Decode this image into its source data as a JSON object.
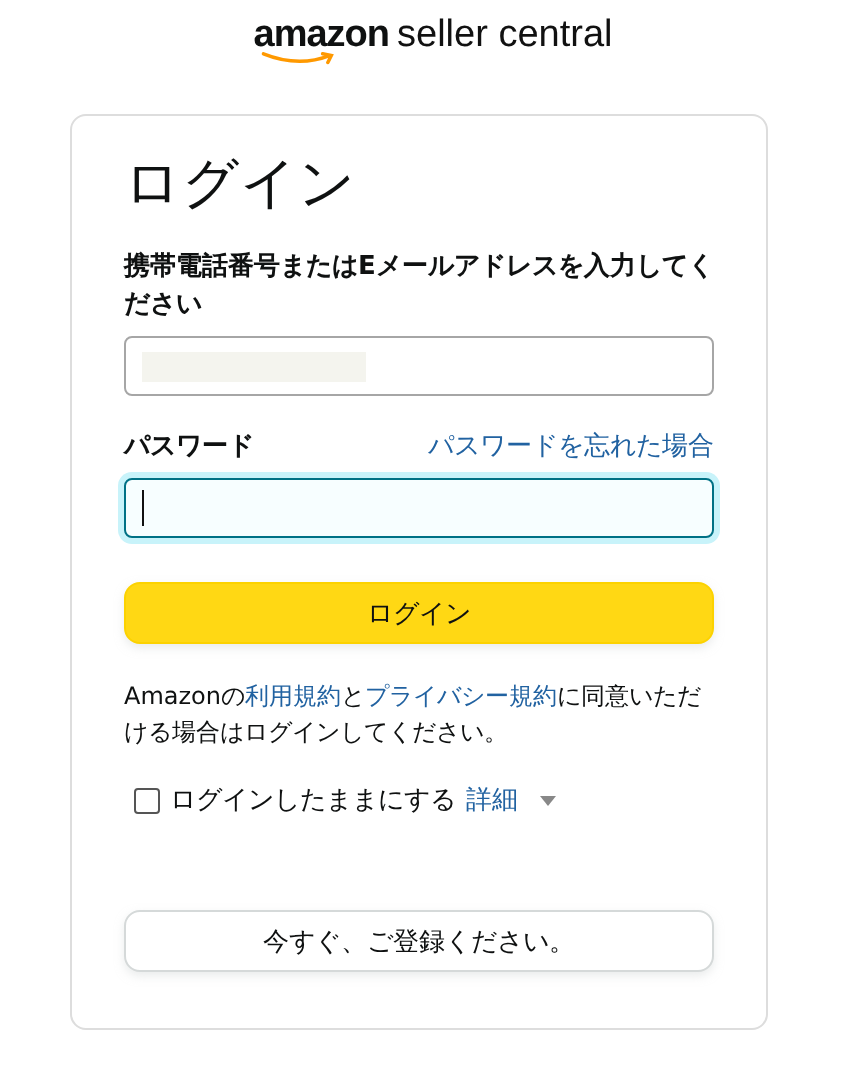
{
  "logo": {
    "brand": "amazon",
    "product": "seller central"
  },
  "title": "ログイン",
  "email": {
    "label": "携帯電話番号またはEメールアドレスを入力してください",
    "redacted": true,
    "focused": false
  },
  "password": {
    "label": "パスワード",
    "forgot_link": "パスワードを忘れた場合",
    "focused": true
  },
  "login_button": "ログイン",
  "agreement": [
    {
      "text": "Amazonの",
      "link": false
    },
    {
      "text": "利用規約",
      "link": true
    },
    {
      "text": "と",
      "link": false
    },
    {
      "text": "プライバシー規約",
      "link": true
    },
    {
      "text": "に同意いただける場合はログインしてください。",
      "link": false
    }
  ],
  "remember": {
    "label": "ログインしたままにする",
    "checked": false,
    "details_link": "詳細"
  },
  "register_button": "今すぐ、ご登録ください。"
}
